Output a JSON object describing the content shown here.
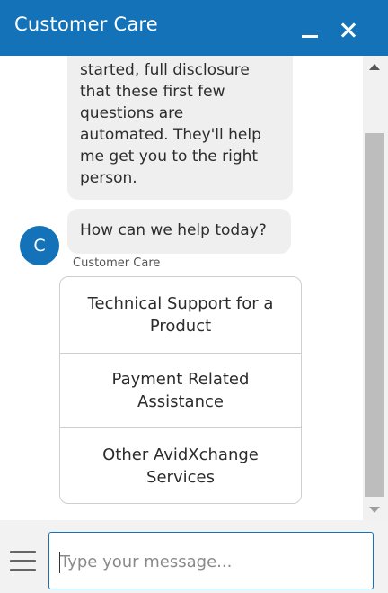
{
  "header": {
    "title": "Customer Care"
  },
  "messages": {
    "bot_message_1": "started, full disclosure\nthat these first few\nquestions are\nautomated. They'll help\nme get you to the right\nperson.",
    "bot_message_2": "How can we help today?",
    "avatar_initial": "C",
    "sender_name": "Customer Care",
    "options": [
      {
        "label": "Technical Support for a Product"
      },
      {
        "label": "Payment Related Assistance"
      },
      {
        "label": "Other AvidXchange Services"
      }
    ]
  },
  "composer": {
    "placeholder": "Type your message..."
  },
  "colors": {
    "brand": "#1473b8",
    "bubble": "#efefef"
  }
}
